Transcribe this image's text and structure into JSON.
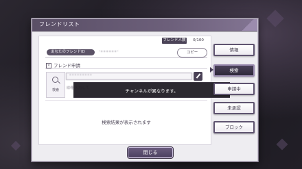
{
  "dialog": {
    "title": "フレンドリスト",
    "friend_count_label": "フレンド人数",
    "friend_count_value": "0/100"
  },
  "my_id": {
    "label": "あなたのフレンドID",
    "value": "'******'",
    "copy_label": "コピー"
  },
  "request": {
    "title": "フレンド申請",
    "search_label": "検索",
    "input_value": "*********",
    "id_label": "IDを入力して",
    "empty_text": "検索結果が表示されます"
  },
  "toast": {
    "message": "チャンネルが異なります。"
  },
  "side_menu": {
    "items": [
      {
        "label": "情報"
      },
      {
        "label": "検索"
      },
      {
        "label": "申請中"
      },
      {
        "label": "未承認"
      },
      {
        "label": "ブロック"
      }
    ],
    "active_index": 1
  },
  "footer": {
    "close_label": "閉じる"
  },
  "colors": {
    "accent": "#5a4f66",
    "panel": "#eeedf1",
    "toast_bg": "#1c1920"
  }
}
